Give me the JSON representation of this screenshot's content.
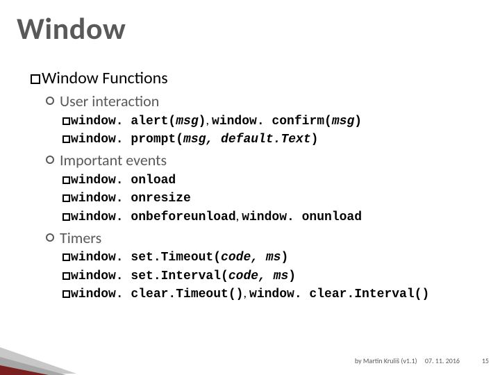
{
  "title": "Window",
  "section_heading_prefix": "Window",
  "section_heading_rest": " Functions",
  "groups": [
    {
      "label": "User interaction",
      "items": [
        {
          "parts": [
            {
              "t": "window. alert(",
              "style": "mono"
            },
            {
              "t": "msg",
              "style": "mono ital"
            },
            {
              "t": ")",
              "style": "mono"
            },
            {
              "t": ", ",
              "style": "plain"
            },
            {
              "t": "window. confirm(",
              "style": "mono"
            },
            {
              "t": "msg",
              "style": "mono ital"
            },
            {
              "t": ")",
              "style": "mono"
            }
          ]
        },
        {
          "parts": [
            {
              "t": "window. prompt(",
              "style": "mono"
            },
            {
              "t": "msg, default.Text",
              "style": "mono ital"
            },
            {
              "t": ")",
              "style": "mono"
            }
          ]
        }
      ]
    },
    {
      "label": "Important events",
      "items": [
        {
          "parts": [
            {
              "t": "window. onload",
              "style": "mono"
            }
          ]
        },
        {
          "parts": [
            {
              "t": "window. onresize",
              "style": "mono"
            }
          ]
        },
        {
          "parts": [
            {
              "t": "window. onbeforeunload",
              "style": "mono"
            },
            {
              "t": ", ",
              "style": "plain"
            },
            {
              "t": "window. onunload",
              "style": "mono"
            }
          ]
        }
      ]
    },
    {
      "label": "Timers",
      "items": [
        {
          "parts": [
            {
              "t": "window. set.Timeout(",
              "style": "mono"
            },
            {
              "t": "code, ms",
              "style": "mono ital"
            },
            {
              "t": ")",
              "style": "mono"
            }
          ]
        },
        {
          "parts": [
            {
              "t": "window. set.Interval(",
              "style": "mono"
            },
            {
              "t": "code, ms",
              "style": "mono ital"
            },
            {
              "t": ")",
              "style": "mono"
            }
          ]
        },
        {
          "parts": [
            {
              "t": "window. clear.Timeout()",
              "style": "mono"
            },
            {
              "t": ", ",
              "style": "plain"
            },
            {
              "t": "window. clear.Interval()",
              "style": "mono"
            }
          ]
        }
      ]
    }
  ],
  "footer_author": "by Martin Kruliš (v1.1)",
  "footer_date": "07. 11. 2016",
  "page_number": "15"
}
